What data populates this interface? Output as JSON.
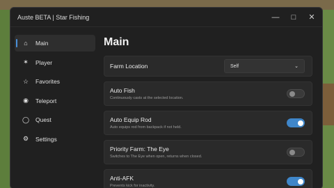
{
  "window": {
    "title": "Auste BETA | Star Fishing"
  },
  "sidebar": {
    "items": [
      {
        "label": "Main",
        "icon": "home-icon",
        "active": true
      },
      {
        "label": "Player",
        "icon": "person-icon"
      },
      {
        "label": "Favorites",
        "icon": "star-icon"
      },
      {
        "label": "Teleport",
        "icon": "map-pin-icon"
      },
      {
        "label": "Quest",
        "icon": "chat-bubble-icon"
      },
      {
        "label": "Settings",
        "icon": "gear-icon"
      }
    ]
  },
  "main": {
    "title": "Main",
    "farm_location": {
      "label": "Farm Location",
      "value": "Self"
    },
    "auto_fish": {
      "title": "Auto Fish",
      "desc": "Continuously casts at the selected location.",
      "on": false
    },
    "auto_equip": {
      "title": "Auto Equip Rod",
      "desc": "Auto equips rod from backpack if not held.",
      "on": true
    },
    "priority_farm": {
      "title": "Priority Farm: The Eye",
      "desc": "Switches to The Eye when open, returns when closed.",
      "on": false
    },
    "anti_afk": {
      "title": "Anti-AFK",
      "desc": "Prevents kick for inactivity.",
      "on": true
    }
  },
  "colors": {
    "accent": "#3f86c9",
    "panel": "#202020"
  }
}
